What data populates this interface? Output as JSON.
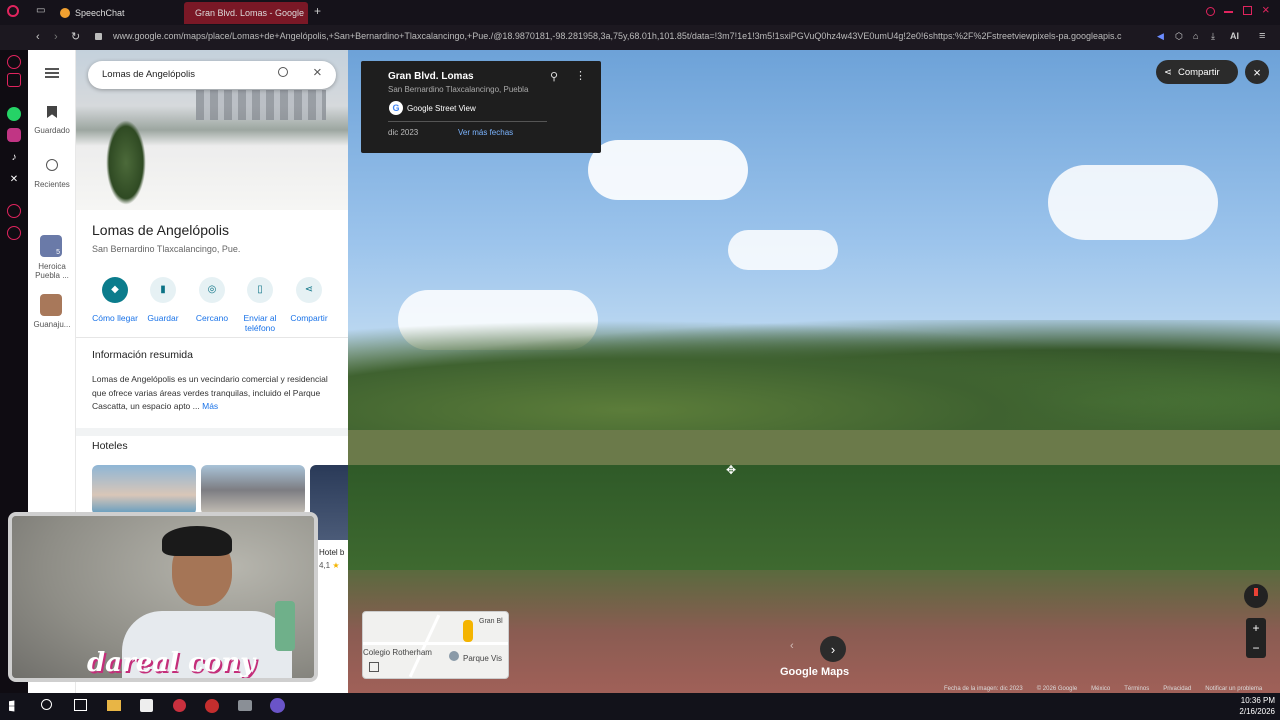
{
  "browser": {
    "tabs": [
      {
        "label": "SpeechChat",
        "active": false
      },
      {
        "label": "Gran Blvd. Lomas - Google",
        "active": true
      }
    ],
    "url": "www.google.com/maps/place/Lomas+de+Angelópolis,+San+Bernardino+Tlaxcalancingo,+Pue./@18.9870181,-98.281958,3a,75y,68.01h,101.85t/data=!3m7!1e1!3m5!1sxiPGVuQ0hz4w43VE0umU4g!2e0!6shttps:%2F%2Fstreetviewpixels-pa.googleapis.c",
    "ai_label": "AI"
  },
  "rail": {
    "saved_label": "Guardado",
    "recent_label": "Recientes",
    "item1_label": "Heroica Puebla ...",
    "item1_badge": "5",
    "item2_label": "Guanaju..."
  },
  "search": {
    "value": "Lomas de Angelópolis"
  },
  "place": {
    "name": "Lomas de Angelópolis",
    "address": "San Bernardino Tlaxcalancingo, Pue."
  },
  "actions": [
    {
      "label": "Cómo llegar"
    },
    {
      "label": "Guardar"
    },
    {
      "label": "Cercano"
    },
    {
      "label": "Enviar al teléfono"
    },
    {
      "label": "Compartir"
    }
  ],
  "summary": {
    "title": "Información resumida",
    "text": "Lomas de Angelópolis es un vecindario comercial y residencial que ofrece varias áreas verdes tranquilas, incluido el Parque Cascatta, un espacio apto ...",
    "more": "Más"
  },
  "hotels": {
    "title": "Hoteles",
    "partial_name": "Hotel b",
    "partial_rating": "4,1"
  },
  "streetview": {
    "card_title": "Gran Blvd. Lomas",
    "card_subtitle": "San Bernardino Tlaxcalancingo, Puebla",
    "provider": "Google Street View",
    "date": "dic 2023",
    "more_dates": "Ver más fechas",
    "share_label": "Compartir",
    "watermark": "Google Maps",
    "minimap_labels": [
      "Colegio Rotherham",
      "Parque Vis",
      "Gran Bl"
    ],
    "footer": [
      "Fecha de la imagen: dic 2023",
      "© 2026 Google",
      "México",
      "Términos",
      "Privacidad",
      "Notificar un problema"
    ]
  },
  "webcam": {
    "overlay": "dareal cony"
  },
  "taskbar": {
    "time": "10:36 PM",
    "date": "2/16/2026"
  }
}
